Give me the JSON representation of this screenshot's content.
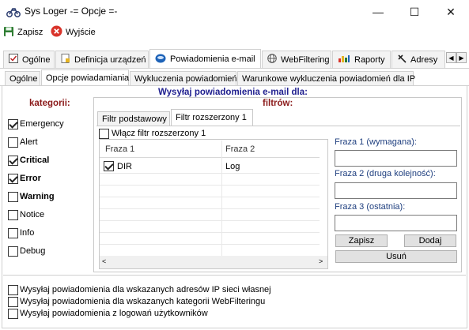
{
  "window": {
    "title": "Sys Loger -= Opcje =-",
    "controls": {
      "minimize": "—",
      "maximize": "☐",
      "close": "✕"
    }
  },
  "toolbar": {
    "save_label": "Zapisz",
    "exit_label": "Wyjście"
  },
  "main_tabs": [
    {
      "label": "Ogólne",
      "icon": "checklist-icon"
    },
    {
      "label": "Definicja urządzeń",
      "icon": "device-doc-icon"
    },
    {
      "label": "Powiadomienia e-mail",
      "icon": "email-icon",
      "active": true
    },
    {
      "label": "WebFiltering",
      "icon": "globe-icon"
    },
    {
      "label": "Raporty",
      "icon": "chart-icon"
    },
    {
      "label": "Adresy",
      "icon": "pin-icon"
    }
  ],
  "sub_tabs": [
    {
      "label": "Ogólne"
    },
    {
      "label": "Opcje powiadamiania",
      "active": true
    },
    {
      "label": "Wykluczenia powiadomień"
    },
    {
      "label": "Warunkowe wykluczenia powiadomień dla IP"
    }
  ],
  "panel": {
    "heading": "Wysyłaj powiadomienia e-mail dla:",
    "categories_heading": "kategorii:",
    "filters_heading": "filtrów:",
    "categories": [
      {
        "label": "Emergency",
        "checked": true,
        "bold": false
      },
      {
        "label": "Alert",
        "checked": false,
        "bold": false
      },
      {
        "label": "Critical",
        "checked": true,
        "bold": true
      },
      {
        "label": "Error",
        "checked": true,
        "bold": true
      },
      {
        "label": "Warning",
        "checked": false,
        "bold": true
      },
      {
        "label": "Notice",
        "checked": false,
        "bold": false
      },
      {
        "label": "Info",
        "checked": false,
        "bold": false
      },
      {
        "label": "Debug",
        "checked": false,
        "bold": false
      }
    ],
    "filter_tabs": [
      {
        "label": "Filtr podstawowy"
      },
      {
        "label": "Filtr rozszerzony 1",
        "active": true
      }
    ],
    "enable_filter_label": "Włącz filtr rozszerzony 1",
    "grid": {
      "columns": [
        "Fraza 1",
        "Fraza 2"
      ],
      "rows": [
        {
          "checked": true,
          "phrase1": "DIR",
          "phrase2": "Log"
        }
      ]
    },
    "fields": {
      "phrase1_label": "Fraza 1 (wymagana):",
      "phrase2_label": "Fraza 2 (druga kolejność):",
      "phrase3_label": "Fraza 3 (ostatnia):",
      "phrase1_value": "",
      "phrase2_value": "",
      "phrase3_value": ""
    },
    "buttons": {
      "save": "Zapisz",
      "add": "Dodaj",
      "delete": "Usuń"
    },
    "bottom_options": [
      {
        "label": "Wysyłaj powiadomienia dla wskazanych adresów IP sieci własnej",
        "checked": false
      },
      {
        "label": "Wysyłaj powiadomienia dla wskazanych kategorii WebFilteringu",
        "checked": false
      },
      {
        "label": "Wysyłaj powiadomienia z logowań użytkowników",
        "checked": false
      }
    ]
  },
  "colors": {
    "heading_blue": "#1f1f8f",
    "heading_red": "#8b1a1a",
    "exit_red": "#d9342b",
    "save_green": "#2e7d32"
  }
}
